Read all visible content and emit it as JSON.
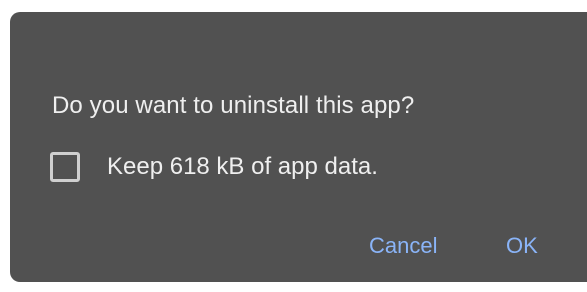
{
  "dialog": {
    "message": "Do you want to uninstall this app?",
    "option": {
      "label": "Keep 618 kB of app data.",
      "checked": false
    },
    "buttons": {
      "cancel_label": "Cancel",
      "ok_label": "OK"
    }
  },
  "colors": {
    "dialog_background": "#515151",
    "text": "#efefef",
    "accent": "#8ab4f8",
    "checkbox_border": "#cfcfcf"
  }
}
